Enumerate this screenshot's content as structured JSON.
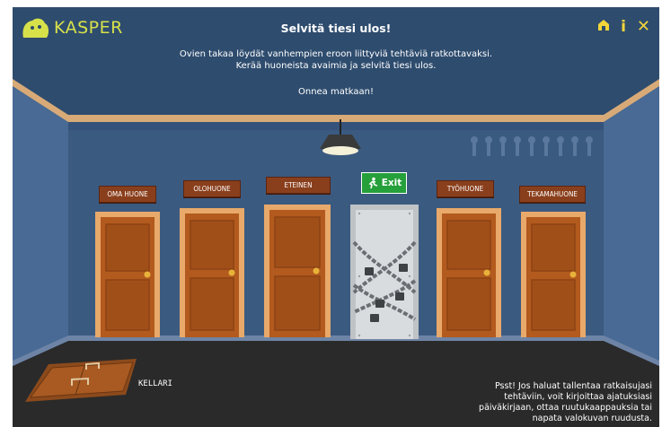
{
  "header": {
    "logo_text": "KASPER",
    "title": "Selvitä tiesi ulos!",
    "intro_line1": "Ovien takaa löydät vanhempien eroon liittyviä tehtäviä ratkottavaksi.",
    "intro_line2": "Kerää huoneista avaimia ja selvitä tiesi ulos.",
    "cheer": "Onnea matkaan!",
    "icons": [
      "home-icon",
      "info-icon",
      "close-icon"
    ],
    "info_label": "i",
    "close_label": "✕"
  },
  "rooms": [
    "OMA HUONE",
    "OLOHUONE",
    "ETEINEN",
    "TYÖHUONE",
    "TEKAMAHUONE"
  ],
  "exit_label": "Exit",
  "cellar_label": "KELLARI",
  "tip_text": "Psst! Jos haluat tallentaa ratkaisujasi tehtäviin, voit kirjoittaa ajatuksiasi päiväkirjaan, ottaa ruutukaappauksia tai napata valokuvan ruudusta.",
  "colors": {
    "wall": "#3b5a80",
    "door": "#b35a1e",
    "sign": "#8a3f1c",
    "exit": "#26a03a",
    "logo": "#d7e24a"
  }
}
